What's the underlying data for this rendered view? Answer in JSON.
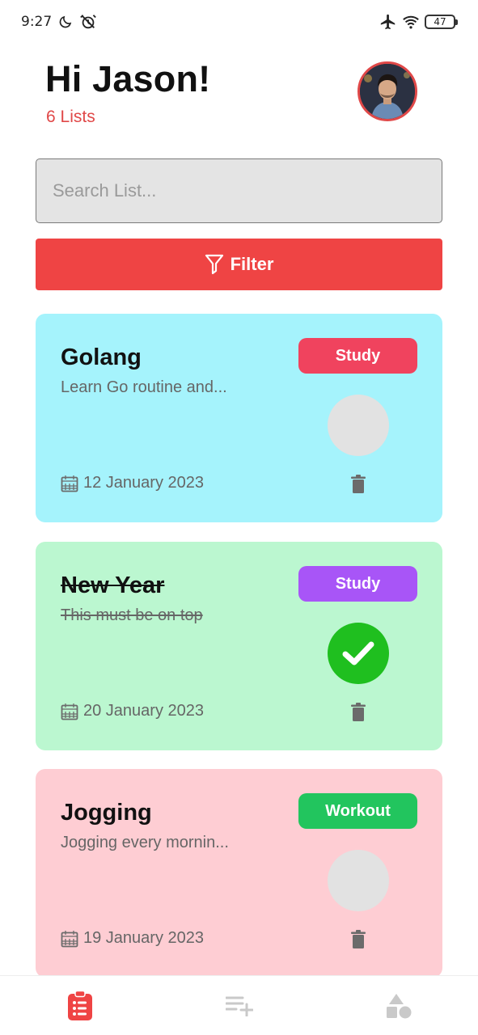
{
  "status": {
    "time": "9:27",
    "battery": "47"
  },
  "header": {
    "greeting": "Hi Jason!",
    "list_count": "6 Lists"
  },
  "search": {
    "placeholder": "Search List..."
  },
  "filter": {
    "label": "Filter"
  },
  "cards": [
    {
      "title": "Golang",
      "description": "Learn Go routine and...",
      "tag": "Study",
      "tag_color": "#f0435e",
      "bg_color": "#a5f3fc",
      "date": "12 January 2023",
      "completed": false
    },
    {
      "title": "New Year",
      "description": "This must be on top",
      "tag": "Study",
      "tag_color": "#a855f7",
      "bg_color": "#bbf7d0",
      "date": "20 January 2023",
      "completed": true
    },
    {
      "title": "Jogging",
      "description": "Jogging every mornin...",
      "tag": "Workout",
      "tag_color": "#22c55e",
      "bg_color": "#fecdd3",
      "date": "19 January 2023",
      "completed": false
    }
  ],
  "colors": {
    "accent": "#ef4444",
    "check_done": "#1fbf1f"
  },
  "icons": {
    "filter": "funnel-icon",
    "calendar": "calendar-icon",
    "trash": "trash-icon",
    "nav": [
      "clipboard-list-icon",
      "playlist-add-icon",
      "shapes-icon"
    ]
  }
}
